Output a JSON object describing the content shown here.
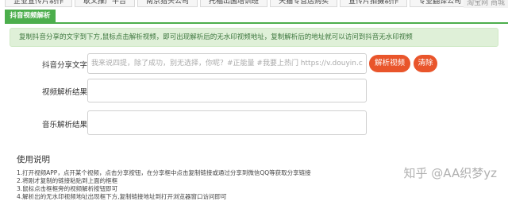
{
  "top_tabs": [
    "企业宣传片制作",
    "耿义推广平台",
    "南京猎头公司",
    "托福出国培训班",
    "天猫专营店购买",
    "宣传片拍摄制作",
    "专业翻译公司",
    "商"
  ],
  "top_watermark": "淘宝网 商城",
  "subtab": "抖音视频解析",
  "notice": "复制抖音分享的文字到下方,鼠标点击解析视频，即可出现解析后的无水印视频地址，复制解析后的地址就可以访问到抖音无水印视频",
  "form": {
    "share_label": "抖音分享文字:",
    "share_placeholder": "我来说四提，除了成功，别无选择，你呢？#正能量 #我要上热门 https://v.douyin.com/JN",
    "parse_button": "解析视频",
    "clear_button": "清除",
    "video_label": "视频解析结果:",
    "music_label": "音乐解析结果:"
  },
  "instructions": {
    "title": "使用说明",
    "items": [
      "1.打开视频APP，点开某个视频，点击分享按钮，在分享框中点击复制链接或通过分享到微信QQ等获取分享链接",
      "2.将刚才复制的链接粘贴到上面的框框",
      "3.鼠标点击框框旁的视频解析按钮即可",
      "4.解析出的无水印视频地址出现框下方,复制链接地址到打开浏览器窗口访问即可"
    ]
  },
  "watermark": "知乎 @AA织梦yz"
}
